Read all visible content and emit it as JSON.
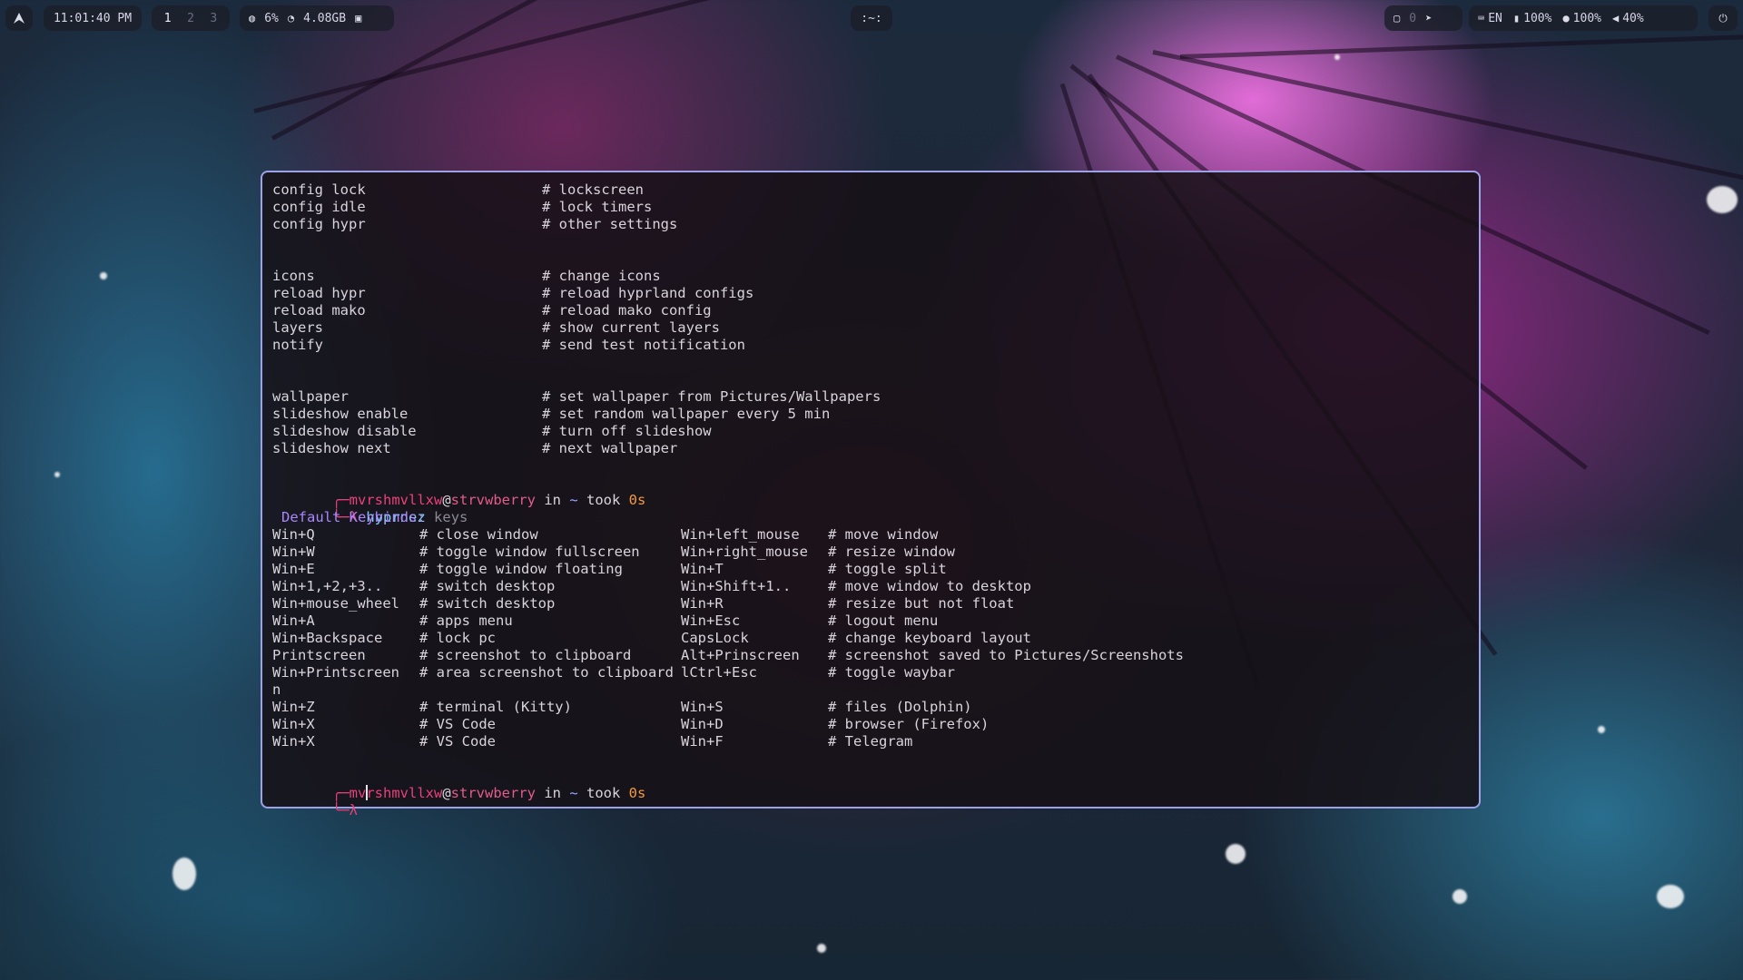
{
  "topbar": {
    "clock": "11:01:40 PM",
    "workspaces": [
      "1",
      "2",
      "3"
    ],
    "cpu": "6%",
    "memory": "4.08GB",
    "window_title": ":~:",
    "tray_count": "0",
    "language": "EN",
    "battery": "100%",
    "mic": "100%",
    "volume": "40%"
  },
  "terminal": {
    "config_rows": [
      {
        "cmd": "config lock",
        "desc": "# lockscreen"
      },
      {
        "cmd": "config idle",
        "desc": "# lock timers"
      },
      {
        "cmd": "config hypr",
        "desc": "# other settings"
      }
    ],
    "util_rows": [
      {
        "cmd": "icons",
        "desc": "# change icons"
      },
      {
        "cmd": "reload hypr",
        "desc": "# reload hyprland configs"
      },
      {
        "cmd": "reload mako",
        "desc": "# reload mako config"
      },
      {
        "cmd": "layers",
        "desc": "# show current layers"
      },
      {
        "cmd": "notify",
        "desc": "# send test notification"
      }
    ],
    "wall_rows": [
      {
        "cmd": "wallpaper",
        "desc": "# set wallpaper from Pictures/Wallpapers"
      },
      {
        "cmd": "slideshow enable",
        "desc": "# set random wallpaper every 5 min"
      },
      {
        "cmd": "slideshow disable",
        "desc": "# turn off slideshow"
      },
      {
        "cmd": "slideshow next",
        "desc": "# next wallpaper"
      }
    ],
    "prompt": {
      "user": "mvrshmvllxw",
      "at": "@",
      "host": "strvwberry",
      "in": " in ",
      "dir": "~",
      "took": " took ",
      "time": "0s",
      "lambda": "λ"
    },
    "command": "hyprnez",
    "command_arg": "keys",
    "keybinds_header": "Default Keybinds:",
    "keybinds": [
      {
        "k1": "Win+Q",
        "d1": "# close window",
        "k2": "Win+left_mouse",
        "d2": "# move window"
      },
      {
        "k1": "Win+W",
        "d1": "# toggle window fullscreen",
        "k2": "Win+right_mouse",
        "d2": "# resize window"
      },
      {
        "k1": "Win+E",
        "d1": "# toggle window floating",
        "k2": "Win+T",
        "d2": "# toggle split"
      },
      {
        "k1": "Win+1,+2,+3..",
        "d1": "# switch desktop",
        "k2": "Win+Shift+1..",
        "d2": "# move window to desktop"
      },
      {
        "k1": "Win+mouse_wheel",
        "d1": "# switch desktop",
        "k2": "Win+R",
        "d2": "# resize but not float"
      },
      {
        "k1": "Win+A",
        "d1": "# apps menu",
        "k2": "Win+Esc",
        "d2": "# logout menu"
      },
      {
        "k1": "Win+Backspace",
        "d1": "# lock pc",
        "k2": "CapsLock",
        "d2": "# change keyboard layout"
      },
      {
        "k1": "Printscreen",
        "d1": "# screenshot to clipboard",
        "k2": "Alt+Prinscreen",
        "d2": "# screenshot saved to Pictures/Screenshots"
      },
      {
        "k1": "Win+Printscreen",
        "d1": "# area screenshot to clipboard",
        "k2": "lCtrl+Esc",
        "d2": "# toggle waybar"
      },
      {
        "k1": "n",
        "d1": "",
        "k2": "",
        "d2": ""
      },
      {
        "k1": "Win+Z",
        "d1": "# terminal (Kitty)",
        "k2": "Win+S",
        "d2": "# files (Dolphin)"
      },
      {
        "k1": "Win+X",
        "d1": "# VS Code",
        "k2": "Win+D",
        "d2": "# browser (Firefox)"
      },
      {
        "k1": "Win+X",
        "d1": "# VS Code",
        "k2": "Win+F",
        "d2": "# Telegram"
      }
    ]
  },
  "icons": {
    "launcher": "arch-logo-icon",
    "cpu": "cpu-icon",
    "memory": "memory-icon",
    "tray": "tray-icon",
    "language": "keyboard-icon",
    "battery": "battery-icon",
    "mic": "microphone-icon",
    "volume": "volume-icon",
    "power": "power-icon"
  },
  "colors": {
    "accent_border": "#9da2e6",
    "prompt_user": "#e9417a",
    "command": "#7fd1f0",
    "header": "#a987ff",
    "duration": "#f39a40"
  }
}
